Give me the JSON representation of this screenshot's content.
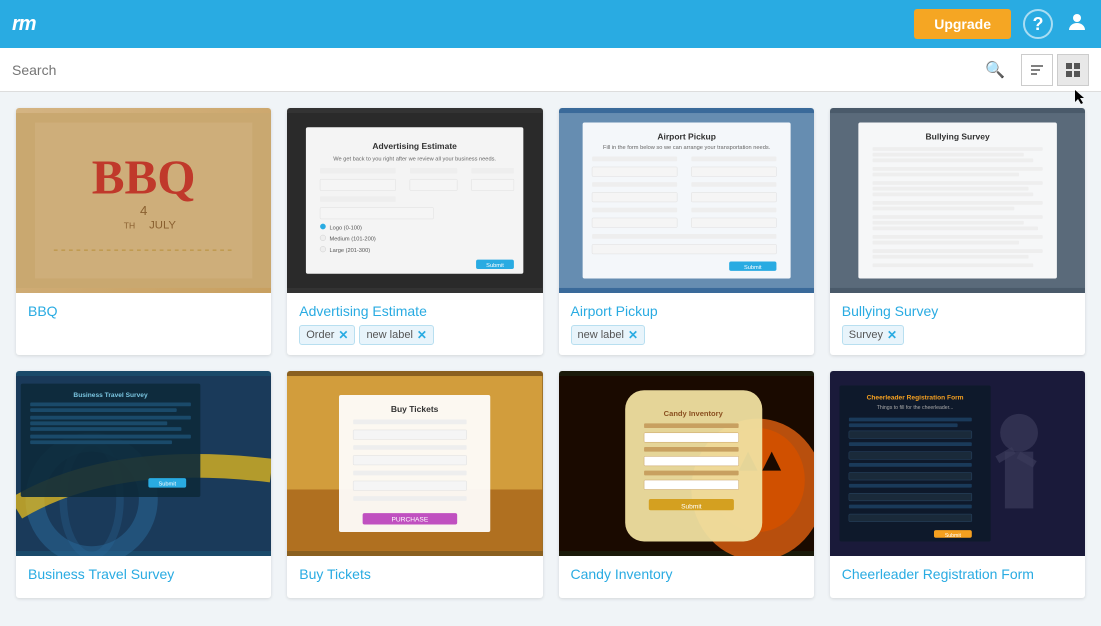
{
  "header": {
    "logo": "rm",
    "upgrade_label": "Upgrade",
    "help_icon": "?",
    "user_icon": "👤"
  },
  "search": {
    "placeholder": "Search",
    "sort_icon": "sort-icon",
    "grid_icon": "grid-icon"
  },
  "cards": [
    {
      "id": "bbq",
      "title": "BBQ",
      "title_display": "",
      "tags": [],
      "thumb_type": "bbq"
    },
    {
      "id": "advertising-estimate",
      "title": "Advertising Estimate",
      "tags": [
        {
          "label": "Order",
          "removable": true
        },
        {
          "label": "new label",
          "removable": true
        }
      ],
      "thumb_type": "adv"
    },
    {
      "id": "airport-pickup",
      "title": "Airport Pickup",
      "tags": [
        {
          "label": "new label",
          "removable": true
        }
      ],
      "thumb_type": "airport"
    },
    {
      "id": "bullying-survey",
      "title": "Bullying Survey",
      "tags": [
        {
          "label": "Survey",
          "removable": true
        }
      ],
      "thumb_type": "bullying"
    },
    {
      "id": "business-travel-survey",
      "title": "Business Travel Survey",
      "tags": [],
      "thumb_type": "business"
    },
    {
      "id": "buy-tickets",
      "title": "Buy Tickets",
      "tags": [],
      "thumb_type": "buy"
    },
    {
      "id": "candy-inventory",
      "title": "Candy Inventory",
      "tags": [],
      "thumb_type": "candy"
    },
    {
      "id": "cheerleader-registration-form",
      "title": "Cheerleader Registration Form",
      "tags": [],
      "thumb_type": "cheer"
    }
  ]
}
